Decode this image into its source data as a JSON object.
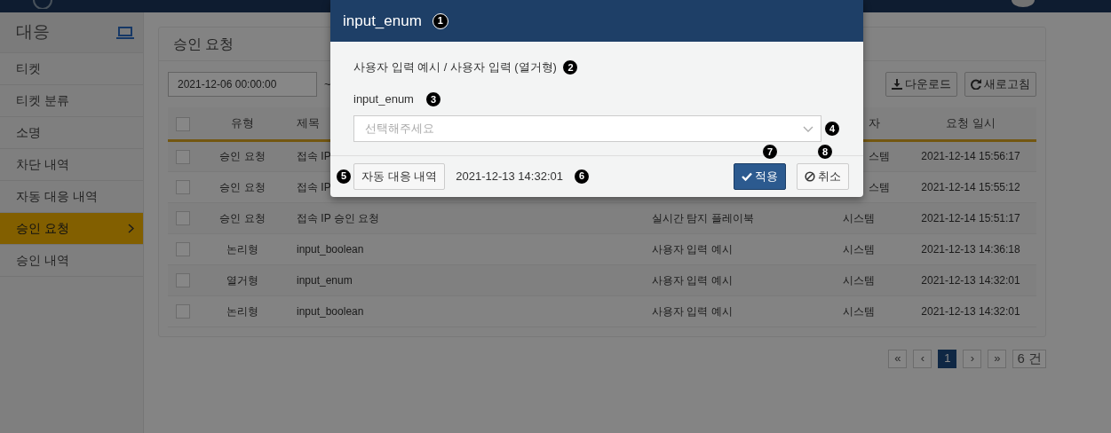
{
  "sidebar": {
    "title": "대응",
    "items": [
      {
        "label": "티켓",
        "selected": false
      },
      {
        "label": "티켓 분류",
        "selected": false
      },
      {
        "label": "소명",
        "selected": false
      },
      {
        "label": "차단 내역",
        "selected": false
      },
      {
        "label": "자동 대응 내역",
        "selected": false
      },
      {
        "label": "승인 요청",
        "selected": true
      },
      {
        "label": "승인 내역",
        "selected": false
      }
    ]
  },
  "panel": {
    "title": "승인 요청",
    "date_from": "2021-12-06 00:00:00",
    "range_separator": "~",
    "buttons": [
      {
        "kind": "download",
        "label": "다운로드"
      },
      {
        "kind": "refresh",
        "label": "새로고침"
      }
    ],
    "table": {
      "header_checked": false,
      "columns": {
        "type": "유형",
        "title": "제목",
        "requester": "자",
        "requested_at": "요청 일시"
      },
      "rows": [
        {
          "checked": false,
          "type": "승인 요청",
          "title": "접속 IP",
          "requester": "스템",
          "requested_at": "2021-12-14 15:56:17"
        },
        {
          "checked": false,
          "type": "승인 요청",
          "title": "접속 IP",
          "requester": "스템",
          "requested_at": "2021-12-14 15:55:12"
        },
        {
          "checked": false,
          "type": "승인 요청",
          "title": "접속 IP 승인 요청",
          "source": "실시간 탐지 플레이북",
          "requester": "시스템",
          "requested_at": "2021-12-14 15:51:17"
        },
        {
          "checked": false,
          "type": "논리형",
          "title": "input_boolean",
          "source": "사용자 입력 예시",
          "requester": "시스템",
          "requested_at": "2021-12-13 14:36:18"
        },
        {
          "checked": false,
          "type": "열거형",
          "title": "input_enum",
          "source": "사용자 입력 예시",
          "requester": "시스템",
          "requested_at": "2021-12-13 14:32:01"
        },
        {
          "checked": false,
          "type": "논리형",
          "title": "input_boolean",
          "source": "사용자 입력 예시",
          "requester": "시스템",
          "requested_at": "2021-12-13 14:32:01"
        }
      ]
    }
  },
  "pagination": {
    "first": "«",
    "prev": "‹",
    "pages": [
      {
        "label": "1",
        "selected": true
      }
    ],
    "next": "›",
    "last": "»",
    "total": "6 건"
  },
  "modal": {
    "title": "input_enum",
    "title_marker": "1",
    "subtitle": "사용자 입력 예시 / 사용자 입력 (열거형)",
    "subtitle_marker": "2",
    "field_label": "input_enum",
    "field_marker": "3",
    "select_placeholder": "선택해주세요",
    "select_marker": "4",
    "history_button": "자동 대응 내역",
    "history_marker": "5",
    "timestamp": "2021-12-13 14:32:01",
    "timestamp_marker": "6",
    "apply": {
      "label": "적용",
      "marker": "7"
    },
    "cancel": {
      "label": "취소",
      "marker": "8"
    }
  }
}
